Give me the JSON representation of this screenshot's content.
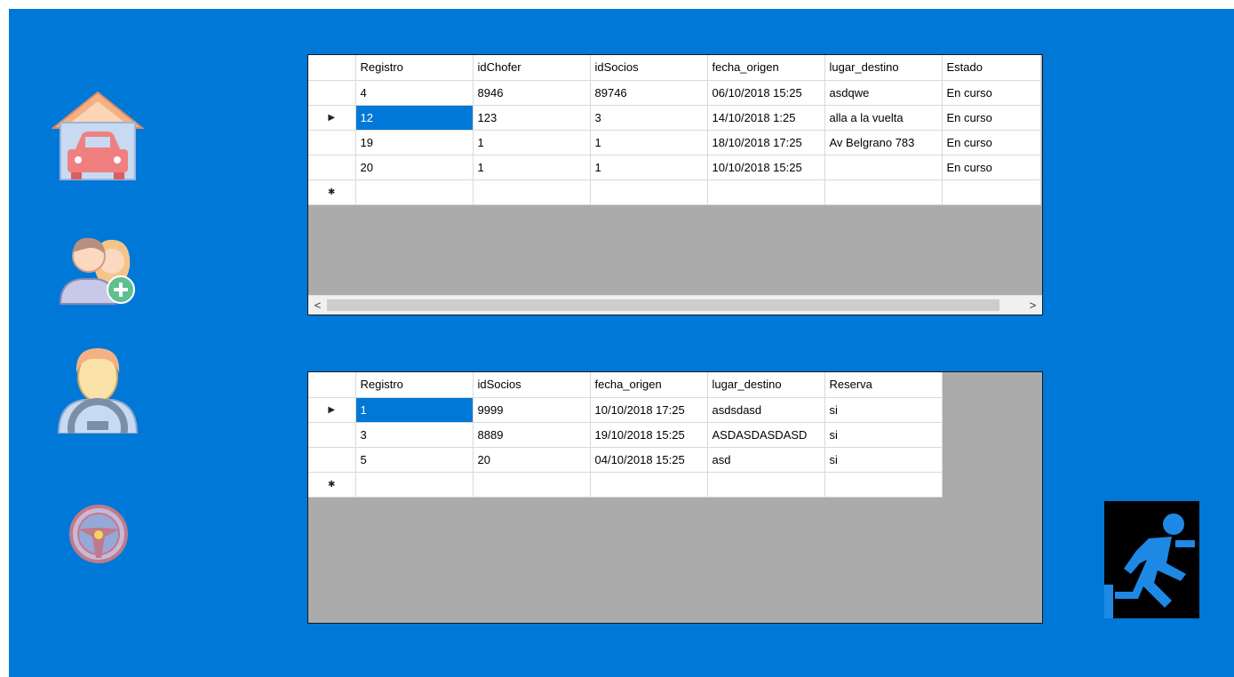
{
  "colors": {
    "form_bg": "#0078d7",
    "grid_bg": "#ababab",
    "selection": "#0078d7"
  },
  "left_icons": [
    {
      "name": "garage-car-icon"
    },
    {
      "name": "add-users-icon"
    },
    {
      "name": "driver-icon"
    },
    {
      "name": "steering-wheel-icon"
    }
  ],
  "exit_icon": {
    "name": "exit-running-man-icon"
  },
  "viajes_grid": {
    "columns": [
      "Registro",
      "idChofer",
      "idSocios",
      "fecha_origen",
      "lugar_destino",
      "Estado"
    ],
    "rows": [
      [
        "4",
        "8946",
        "89746",
        "06/10/2018 15:25",
        "asdqwe",
        "En curso"
      ],
      [
        "12",
        "123",
        "3",
        "14/10/2018 1:25",
        "alla a la vuelta",
        "En curso"
      ],
      [
        "19",
        "1",
        "1",
        "18/10/2018 17:25",
        "Av Belgrano 783",
        "En curso"
      ],
      [
        "20",
        "1",
        "1",
        "10/10/2018 15:25",
        "",
        "En curso"
      ]
    ],
    "current_row_marker": "▶",
    "new_row_marker": "✱",
    "scroll_left": "<",
    "scroll_right": ">"
  },
  "reservas_grid": {
    "columns": [
      "Registro",
      "idSocios",
      "fecha_origen",
      "lugar_destino",
      "Reserva"
    ],
    "rows": [
      [
        "1",
        "9999",
        "10/10/2018 17:25",
        "asdsdasd",
        "si"
      ],
      [
        "3",
        "8889",
        "19/10/2018 15:25",
        "ASDASDASDASD",
        "si"
      ],
      [
        "5",
        "20",
        "04/10/2018 15:25",
        "asd",
        "si"
      ]
    ],
    "current_row_marker": "▶",
    "new_row_marker": "✱"
  }
}
